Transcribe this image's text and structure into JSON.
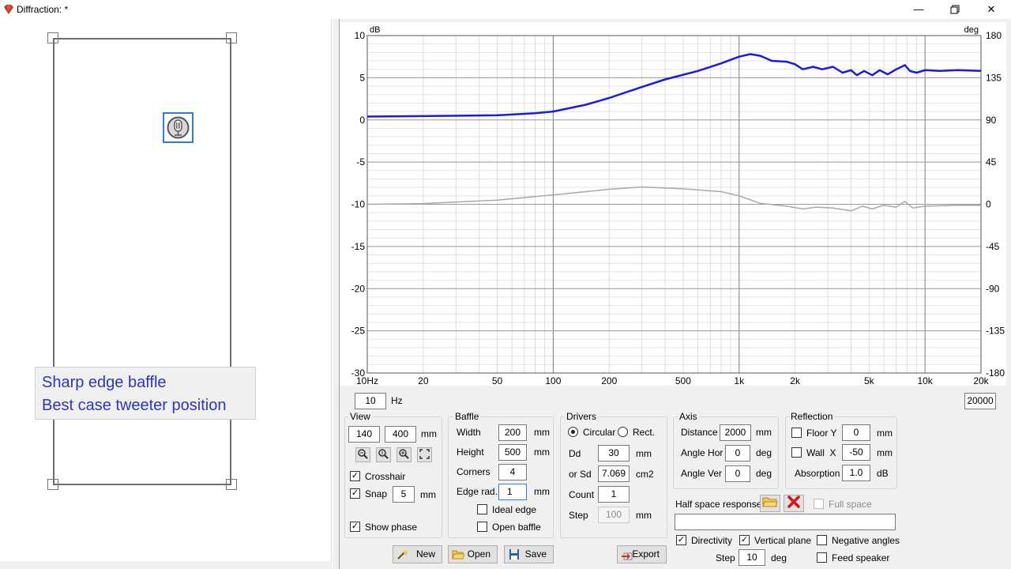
{
  "window": {
    "title": "Diffraction: *",
    "controls": [
      "minimize",
      "restore",
      "close"
    ],
    "accent": "#2f7fd7"
  },
  "annotation": {
    "line1": "Sharp edge baffle",
    "line2": "Best case tweeter position",
    "color": "#2b35c8"
  },
  "chart_data": {
    "type": "line",
    "x_scale": "log",
    "xlim": [
      10,
      20000
    ],
    "x_ticks": [
      "10Hz",
      "20",
      "50",
      "100",
      "200",
      "500",
      "1k",
      "2k",
      "5k",
      "10k",
      "20k"
    ],
    "ylabel": "dB",
    "ylim": [
      -30,
      10
    ],
    "y_ticks": [
      "10",
      "5",
      "0",
      "-5",
      "-10",
      "-15",
      "-20",
      "-25",
      "-30"
    ],
    "y2label": "deg",
    "y2lim": [
      -180,
      180
    ],
    "y2_ticks": [
      "180",
      "135",
      "90",
      "45",
      "0",
      "-45",
      "-90",
      "-135",
      "-180"
    ],
    "grid": true,
    "series": [
      {
        "color": "#1a1ae6",
        "axis": "left",
        "points": [
          [
            10,
            0.4
          ],
          [
            20,
            0.45
          ],
          [
            50,
            0.55
          ],
          [
            80,
            0.8
          ],
          [
            100,
            1.0
          ],
          [
            150,
            1.8
          ],
          [
            200,
            2.6
          ],
          [
            300,
            3.9
          ],
          [
            400,
            4.8
          ],
          [
            600,
            5.8
          ],
          [
            800,
            6.7
          ],
          [
            1000,
            7.5
          ],
          [
            1150,
            7.8
          ],
          [
            1300,
            7.6
          ],
          [
            1500,
            7.0
          ],
          [
            1800,
            6.9
          ],
          [
            2000,
            6.6
          ],
          [
            2200,
            6.0
          ],
          [
            2500,
            6.3
          ],
          [
            2800,
            6.0
          ],
          [
            3200,
            6.3
          ],
          [
            3600,
            5.6
          ],
          [
            4000,
            5.9
          ],
          [
            4300,
            5.3
          ],
          [
            4700,
            5.8
          ],
          [
            5200,
            5.3
          ],
          [
            5700,
            5.9
          ],
          [
            6300,
            5.4
          ],
          [
            7000,
            6.0
          ],
          [
            7800,
            6.5
          ],
          [
            8300,
            5.8
          ],
          [
            9000,
            5.6
          ],
          [
            10000,
            5.9
          ],
          [
            12000,
            5.8
          ],
          [
            15000,
            5.9
          ],
          [
            20000,
            5.8
          ]
        ]
      },
      {
        "color": "#a8a8a8",
        "axis": "right",
        "points": [
          [
            10,
            0
          ],
          [
            20,
            0.8
          ],
          [
            50,
            4.5
          ],
          [
            100,
            10
          ],
          [
            200,
            16
          ],
          [
            300,
            18.5
          ],
          [
            500,
            16.5
          ],
          [
            800,
            13.5
          ],
          [
            1000,
            9
          ],
          [
            1300,
            1
          ],
          [
            1800,
            -2
          ],
          [
            2200,
            -5
          ],
          [
            2600,
            -3
          ],
          [
            3200,
            -4
          ],
          [
            4000,
            -7
          ],
          [
            4600,
            -2
          ],
          [
            5200,
            -5
          ],
          [
            6000,
            -1
          ],
          [
            7000,
            -3
          ],
          [
            7800,
            3
          ],
          [
            8600,
            -4
          ],
          [
            10000,
            -2
          ],
          [
            15000,
            -1
          ],
          [
            20000,
            -1
          ]
        ]
      }
    ]
  },
  "freq_range": {
    "min_value": "10",
    "unit": "Hz",
    "max_value": "20000"
  },
  "view": {
    "label": "View",
    "width": "140",
    "height": "400",
    "unit": "mm",
    "crosshair_label": "Crosshair",
    "crosshair": true,
    "snap_label": "Snap",
    "snap": true,
    "snap_value": "5",
    "snap_unit": "mm",
    "show_phase_label": "Show phase",
    "show_phase": true
  },
  "baffle": {
    "label": "Baffle",
    "width_label": "Width",
    "width": "200",
    "width_unit": "mm",
    "height_label": "Height",
    "height": "500",
    "height_unit": "mm",
    "corners_label": "Corners",
    "corners": "4",
    "edge_label": "Edge rad.",
    "edge": "1",
    "edge_unit": "mm",
    "ideal_edge_label": "Ideal edge",
    "ideal_edge": false,
    "open_baffle_label": "Open baffle",
    "open_baffle": false
  },
  "drivers": {
    "label": "Drivers",
    "circular_label": "Circular",
    "rect_label": "Rect.",
    "shape": "circular",
    "dd_label": "Dd",
    "dd": "30",
    "dd_unit": "mm",
    "sd_label": "or Sd",
    "sd": "7.069",
    "sd_unit": "cm2",
    "count_label": "Count",
    "count": "1",
    "step_label": "Step",
    "step": "100",
    "step_unit": "mm"
  },
  "axis": {
    "label": "Axis",
    "distance_label": "Distance",
    "distance": "2000",
    "distance_unit": "mm",
    "hor_label": "Angle Hor",
    "hor": "0",
    "hor_unit": "deg",
    "ver_label": "Angle Ver",
    "ver": "0",
    "ver_unit": "deg"
  },
  "reflection": {
    "label": "Reflection",
    "floor_label": "Floor Y",
    "floor": false,
    "floor_value": "0",
    "floor_unit": "mm",
    "wall_label": "Wall  X",
    "wall": false,
    "wall_value": "-50",
    "wall_unit": "mm",
    "absorption_label": "Absorption",
    "absorption": "1.0",
    "absorption_unit": "dB"
  },
  "half_space": {
    "label": "Half space response",
    "full_space_label": "Full space",
    "full_space": false,
    "path": ""
  },
  "directivity": {
    "directivity_label": "Directivity",
    "directivity": true,
    "vertical_label": "Vertical plane",
    "vertical": true,
    "negative_label": "Negative angles",
    "negative": false,
    "feed_label": "Feed speaker",
    "feed": false,
    "step_label": "Step",
    "step": "10",
    "step_unit": "deg"
  },
  "buttons": {
    "new": "New",
    "open": "Open",
    "save": "Save",
    "export": "Export"
  }
}
